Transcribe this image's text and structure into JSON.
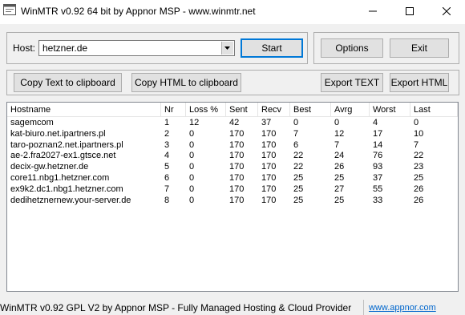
{
  "window": {
    "title": "WinMTR v0.92 64 bit by Appnor MSP - www.winmtr.net"
  },
  "host": {
    "label": "Host:",
    "value": "hetzner.de"
  },
  "buttons": {
    "start": "Start",
    "options": "Options",
    "exit": "Exit",
    "copy_text": "Copy Text to clipboard",
    "copy_html": "Copy HTML to clipboard",
    "export_text": "Export TEXT",
    "export_html": "Export HTML"
  },
  "table": {
    "columns": [
      "Hostname",
      "Nr",
      "Loss %",
      "Sent",
      "Recv",
      "Best",
      "Avrg",
      "Worst",
      "Last"
    ],
    "rows": [
      [
        "sagemcom",
        "1",
        "12",
        "42",
        "37",
        "0",
        "0",
        "4",
        "0"
      ],
      [
        "kat-biuro.net.ipartners.pl",
        "2",
        "0",
        "170",
        "170",
        "7",
        "12",
        "17",
        "10"
      ],
      [
        "taro-poznan2.net.ipartners.pl",
        "3",
        "0",
        "170",
        "170",
        "6",
        "7",
        "14",
        "7"
      ],
      [
        "ae-2.fra2027-ex1.gtsce.net",
        "4",
        "0",
        "170",
        "170",
        "22",
        "24",
        "76",
        "22"
      ],
      [
        "decix-gw.hetzner.de",
        "5",
        "0",
        "170",
        "170",
        "22",
        "26",
        "93",
        "23"
      ],
      [
        "core11.nbg1.hetzner.com",
        "6",
        "0",
        "170",
        "170",
        "25",
        "25",
        "37",
        "25"
      ],
      [
        "ex9k2.dc1.nbg1.hetzner.com",
        "7",
        "0",
        "170",
        "170",
        "25",
        "27",
        "55",
        "26"
      ],
      [
        "dedihetznernew.your-server.de",
        "8",
        "0",
        "170",
        "170",
        "25",
        "25",
        "33",
        "26"
      ]
    ]
  },
  "status": {
    "text": "WinMTR v0.92 GPL V2 by Appnor MSP - Fully Managed Hosting & Cloud Provider",
    "link": "www.appnor.com"
  }
}
